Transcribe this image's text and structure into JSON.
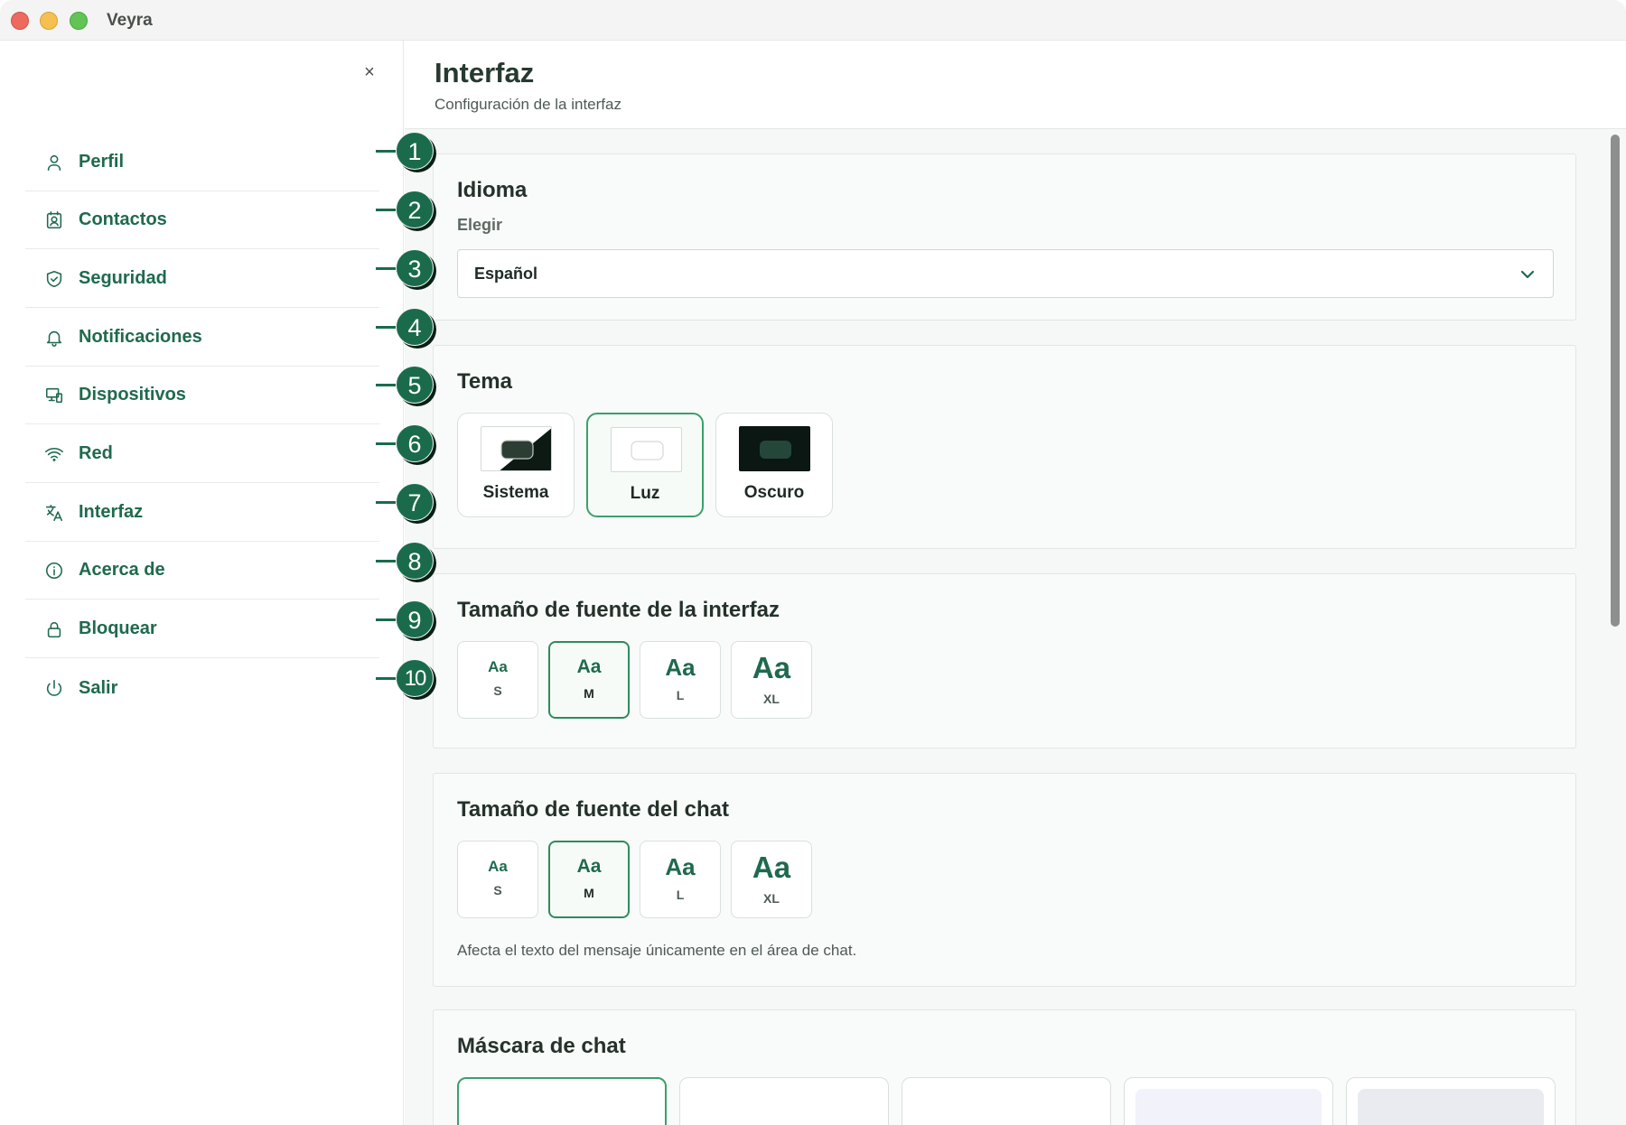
{
  "window": {
    "title": "Veyra"
  },
  "sidebar": {
    "close_label": "×",
    "items": [
      {
        "label": "Perfil",
        "icon": "user-icon",
        "callout": "1"
      },
      {
        "label": "Contactos",
        "icon": "contact-card-icon",
        "callout": "2"
      },
      {
        "label": "Seguridad",
        "icon": "shield-icon",
        "callout": "3"
      },
      {
        "label": "Notificaciones",
        "icon": "bell-icon",
        "callout": "4"
      },
      {
        "label": "Dispositivos",
        "icon": "devices-icon",
        "callout": "5"
      },
      {
        "label": "Red",
        "icon": "wifi-icon",
        "callout": "6"
      },
      {
        "label": "Interfaz",
        "icon": "translate-icon",
        "callout": "7"
      },
      {
        "label": "Acerca de",
        "icon": "info-icon",
        "callout": "8"
      },
      {
        "label": "Bloquear",
        "icon": "lock-icon",
        "callout": "9"
      },
      {
        "label": "Salir",
        "icon": "power-icon",
        "callout": "10"
      }
    ]
  },
  "header": {
    "title": "Interfaz",
    "subtitle": "Configuración de la interfaz"
  },
  "language": {
    "title": "Idioma",
    "label": "Elegir",
    "value": "Español"
  },
  "theme": {
    "title": "Tema",
    "options": [
      {
        "label": "Sistema"
      },
      {
        "label": "Luz",
        "selected": true
      },
      {
        "label": "Oscuro"
      }
    ]
  },
  "ui_font": {
    "title": "Tamaño de fuente de la interfaz",
    "options": [
      {
        "sample": "Aa",
        "label": "S"
      },
      {
        "sample": "Aa",
        "label": "M",
        "selected": true
      },
      {
        "sample": "Aa",
        "label": "L"
      },
      {
        "sample": "Aa",
        "label": "XL"
      }
    ]
  },
  "chat_font": {
    "title": "Tamaño de fuente del chat",
    "options": [
      {
        "sample": "Aa",
        "label": "S"
      },
      {
        "sample": "Aa",
        "label": "M",
        "selected": true
      },
      {
        "sample": "Aa",
        "label": "L"
      },
      {
        "sample": "Aa",
        "label": "XL"
      }
    ],
    "note": "Afecta el texto del mensaje únicamente en el área de chat."
  },
  "chat_mask": {
    "title": "Máscara de chat"
  },
  "colors": {
    "accent": "#1f6a4d",
    "selected_border": "#3aa06c",
    "callout": "#1a6b4c"
  }
}
